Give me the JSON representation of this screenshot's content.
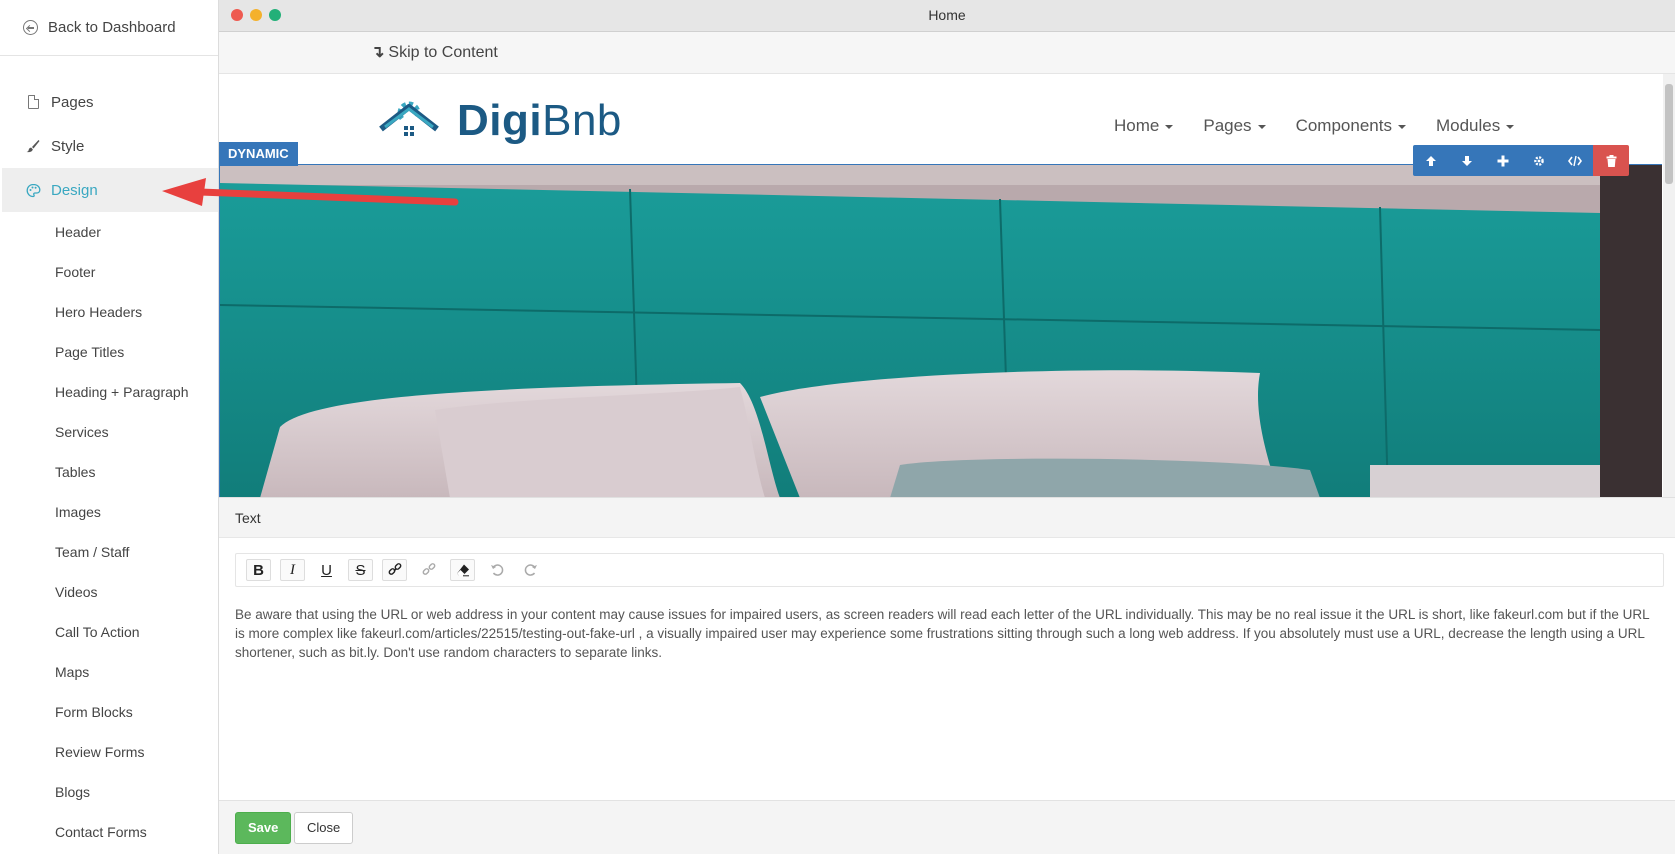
{
  "sidebar": {
    "back_label": "Back to Dashboard",
    "main_items": [
      {
        "label": "Pages",
        "icon": "page-icon"
      },
      {
        "label": "Style",
        "icon": "brush-icon"
      },
      {
        "label": "Design",
        "icon": "palette-icon",
        "active": true
      }
    ],
    "sub_items": [
      "Header",
      "Footer",
      "Hero Headers",
      "Page Titles",
      "Heading + Paragraph",
      "Services",
      "Tables",
      "Images",
      "Team / Staff",
      "Videos",
      "Call To Action",
      "Maps",
      "Form Blocks",
      "Review Forms",
      "Blogs",
      "Contact Forms"
    ]
  },
  "window": {
    "title": "Home"
  },
  "site": {
    "skip_label": "Skip to Content",
    "logo_bold": "Digi",
    "logo_light": "Bnb",
    "menu": [
      "Home",
      "Pages",
      "Components",
      "Modules"
    ],
    "badge": "DYNAMIC"
  },
  "editor": {
    "title": "Text",
    "body": "Be aware that using the URL or web address in your content may cause issues for impaired users, as screen readers will read each letter of the URL individually. This may be no real issue it the URL is short, like fakeurl.com but if the URL is more complex like fakeurl.com/articles/22515/testing-out-fake-url , a visually impaired user may experience some frustrations sitting through such a long web address. If you absolutely must use a URL, decrease the length using a URL shortener, such as bit.ly. Don't use random characters to separate links.",
    "save_label": "Save",
    "close_label": "Close"
  },
  "colors": {
    "accent": "#3aa8c1",
    "brand": "#1c5a84",
    "toolbar": "#3676b9",
    "danger": "#d9534f",
    "save": "#5cb85c",
    "arrow": "#e8403e"
  }
}
